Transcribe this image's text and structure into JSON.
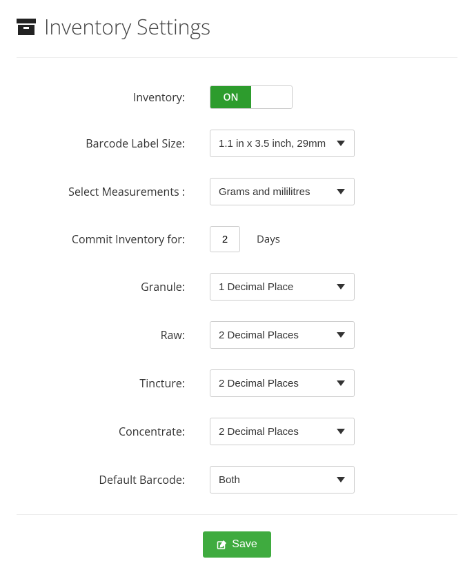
{
  "page": {
    "title": "Inventory Settings"
  },
  "form": {
    "inventory": {
      "label": "Inventory:",
      "on_label": "ON"
    },
    "barcode_label_size": {
      "label": "Barcode Label Size:",
      "value": "1.1 in x 3.5 inch, 29mm"
    },
    "measurements": {
      "label": "Select Measurements :",
      "value": "Grams and mililitres"
    },
    "commit_inventory": {
      "label": "Commit Inventory for:",
      "value": "2",
      "unit": "Days"
    },
    "granule": {
      "label": "Granule:",
      "value": "1 Decimal Place"
    },
    "raw": {
      "label": "Raw:",
      "value": "2 Decimal Places"
    },
    "tincture": {
      "label": "Tincture:",
      "value": "2 Decimal Places"
    },
    "concentrate": {
      "label": "Concentrate:",
      "value": "2 Decimal Places"
    },
    "default_barcode": {
      "label": "Default Barcode:",
      "value": "Both"
    }
  },
  "actions": {
    "save": "Save"
  }
}
